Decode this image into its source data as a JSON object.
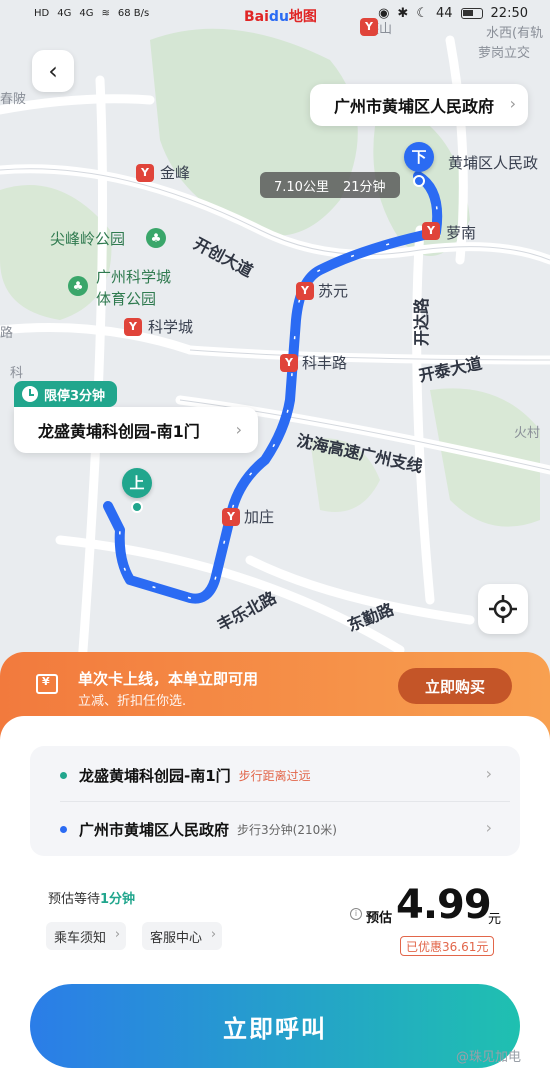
{
  "status_bar": {
    "left": [
      "HD",
      "4G",
      "4G",
      "WiFi",
      "68 B/s"
    ],
    "app_logo_main": "Bai",
    "app_logo_du": "du",
    "app_logo_suffix": "地图",
    "time": "22:50",
    "battery_text": "44"
  },
  "map": {
    "labels": {
      "jin_feng": "金峰",
      "jian_feng_ling": "尖峰岭公园",
      "kexue_cheng_ti": "广州科学城",
      "kexue_cheng_ti2": "体育公园",
      "kexue_cheng": "科学城",
      "su_yuan": "苏元",
      "ke_feng_lu": "科丰路",
      "jia_zhuang": "加庄",
      "luo_nan": "萝南",
      "huangpu_gov_map": "黄埔区人民政",
      "yan_shan": "燕山",
      "luo_gang": "萝岗立交",
      "shui_xi": "水西(有轨",
      "huo_cun": "火村",
      "bo": "春陂",
      "ke": "科",
      "lu": "路"
    },
    "roads": {
      "kaichuang": "开创大道",
      "kaida": "开达路",
      "kaitai": "开泰大道",
      "shenhai": "沈海高速广州支线",
      "fengle": "丰乐北路",
      "dongqin": "东勤路"
    },
    "route_info": {
      "distance": "7.10公里",
      "duration": "21分钟"
    },
    "dest_pin": "下",
    "pickup_pin": "上",
    "route_color": "#2b6bf3"
  },
  "destination": {
    "name": "广州市黄埔区人民政府"
  },
  "pickup": {
    "stop_limit": "限停3分钟",
    "name": "龙盛黄埔科创园-南1门"
  },
  "promo": {
    "title": "单次卡上线，本单立即可用",
    "subtitle": "立减、折扣任你选.",
    "buy_label": "立即购买"
  },
  "addresses": [
    {
      "name": "龙盛黄埔科创园-南1门",
      "note": "步行距离过远",
      "dot_color": "#21a68d",
      "note_color": "#e2664a"
    },
    {
      "name": "广州市黄埔区人民政府",
      "note": "步行3分钟(210米)",
      "dot_color": "#2b6bf3",
      "note_color": "#666666"
    }
  ],
  "wait": {
    "prefix": "预估等待",
    "value": "1分钟"
  },
  "chips": {
    "rules": "乘车须知",
    "service": "客服中心"
  },
  "price": {
    "label": "预估",
    "value": "4.99",
    "unit": "元",
    "discount": "已优惠36.61元"
  },
  "call_button": "立即呼叫",
  "watermark": "@珠见加电"
}
